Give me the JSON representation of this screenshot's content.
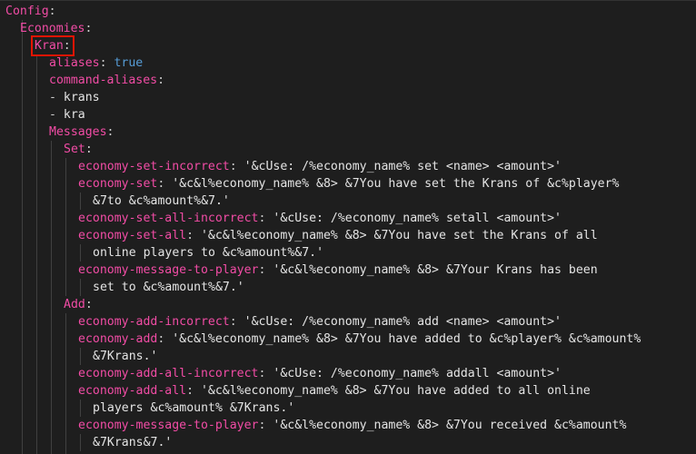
{
  "lines": [
    {
      "key": "Config",
      "colon": ":"
    },
    {
      "key": "Economies",
      "colon": ":"
    },
    {
      "key": "Kran",
      "colon": ":"
    },
    {
      "key": "aliases",
      "colon": ": ",
      "value": "true"
    },
    {
      "key": "command-aliases",
      "colon": ":"
    },
    {
      "dash": "- ",
      "value": "krans"
    },
    {
      "dash": "- ",
      "value": "kra"
    },
    {
      "key": "Messages",
      "colon": ":"
    },
    {
      "key": "Set",
      "colon": ":"
    },
    {
      "key": "economy-set-incorrect",
      "colon": ": ",
      "value": "'&cUse: /%economy_name% set <name> <amount>'"
    },
    {
      "key": "economy-set",
      "colon": ": ",
      "value": "'&c&l%economy_name% &8> &7You have set the Krans of &c%player%"
    },
    {
      "value": "&7to &c%amount%&7.'"
    },
    {
      "key": "economy-set-all-incorrect",
      "colon": ": ",
      "value": "'&cUse: /%economy_name% setall <amount>'"
    },
    {
      "key": "economy-set-all",
      "colon": ": ",
      "value": "'&c&l%economy_name% &8> &7You have set the Krans of all"
    },
    {
      "value": "online players to &c%amount%&7.'"
    },
    {
      "key": "economy-message-to-player",
      "colon": ": ",
      "value": "'&c&l%economy_name% &8> &7Your Krans has been"
    },
    {
      "value": "set to &c%amount%&7.'"
    },
    {
      "key": "Add",
      "colon": ":"
    },
    {
      "key": "economy-add-incorrect",
      "colon": ": ",
      "value": "'&cUse: /%economy_name% add <name> <amount>'"
    },
    {
      "key": "economy-add",
      "colon": ": ",
      "value": "'&c&l%economy_name% &8> &7You have added to &c%player% &c%amount%"
    },
    {
      "value": "&7Krans.'"
    },
    {
      "key": "economy-add-all-incorrect",
      "colon": ": ",
      "value": "'&cUse: /%economy_name% addall <amount>'"
    },
    {
      "key": "economy-add-all",
      "colon": ": ",
      "value": "'&c&l%economy_name% &8> &7You have added to all online"
    },
    {
      "value": "players &c%amount% &7Krans.'"
    },
    {
      "key": "economy-message-to-player",
      "colon": ": ",
      "value": "'&c&l%economy_name% &8> &7You received &c%amount%"
    },
    {
      "value": "&7Krans&7.'"
    }
  ],
  "highlight": {
    "color": "#e51400"
  }
}
